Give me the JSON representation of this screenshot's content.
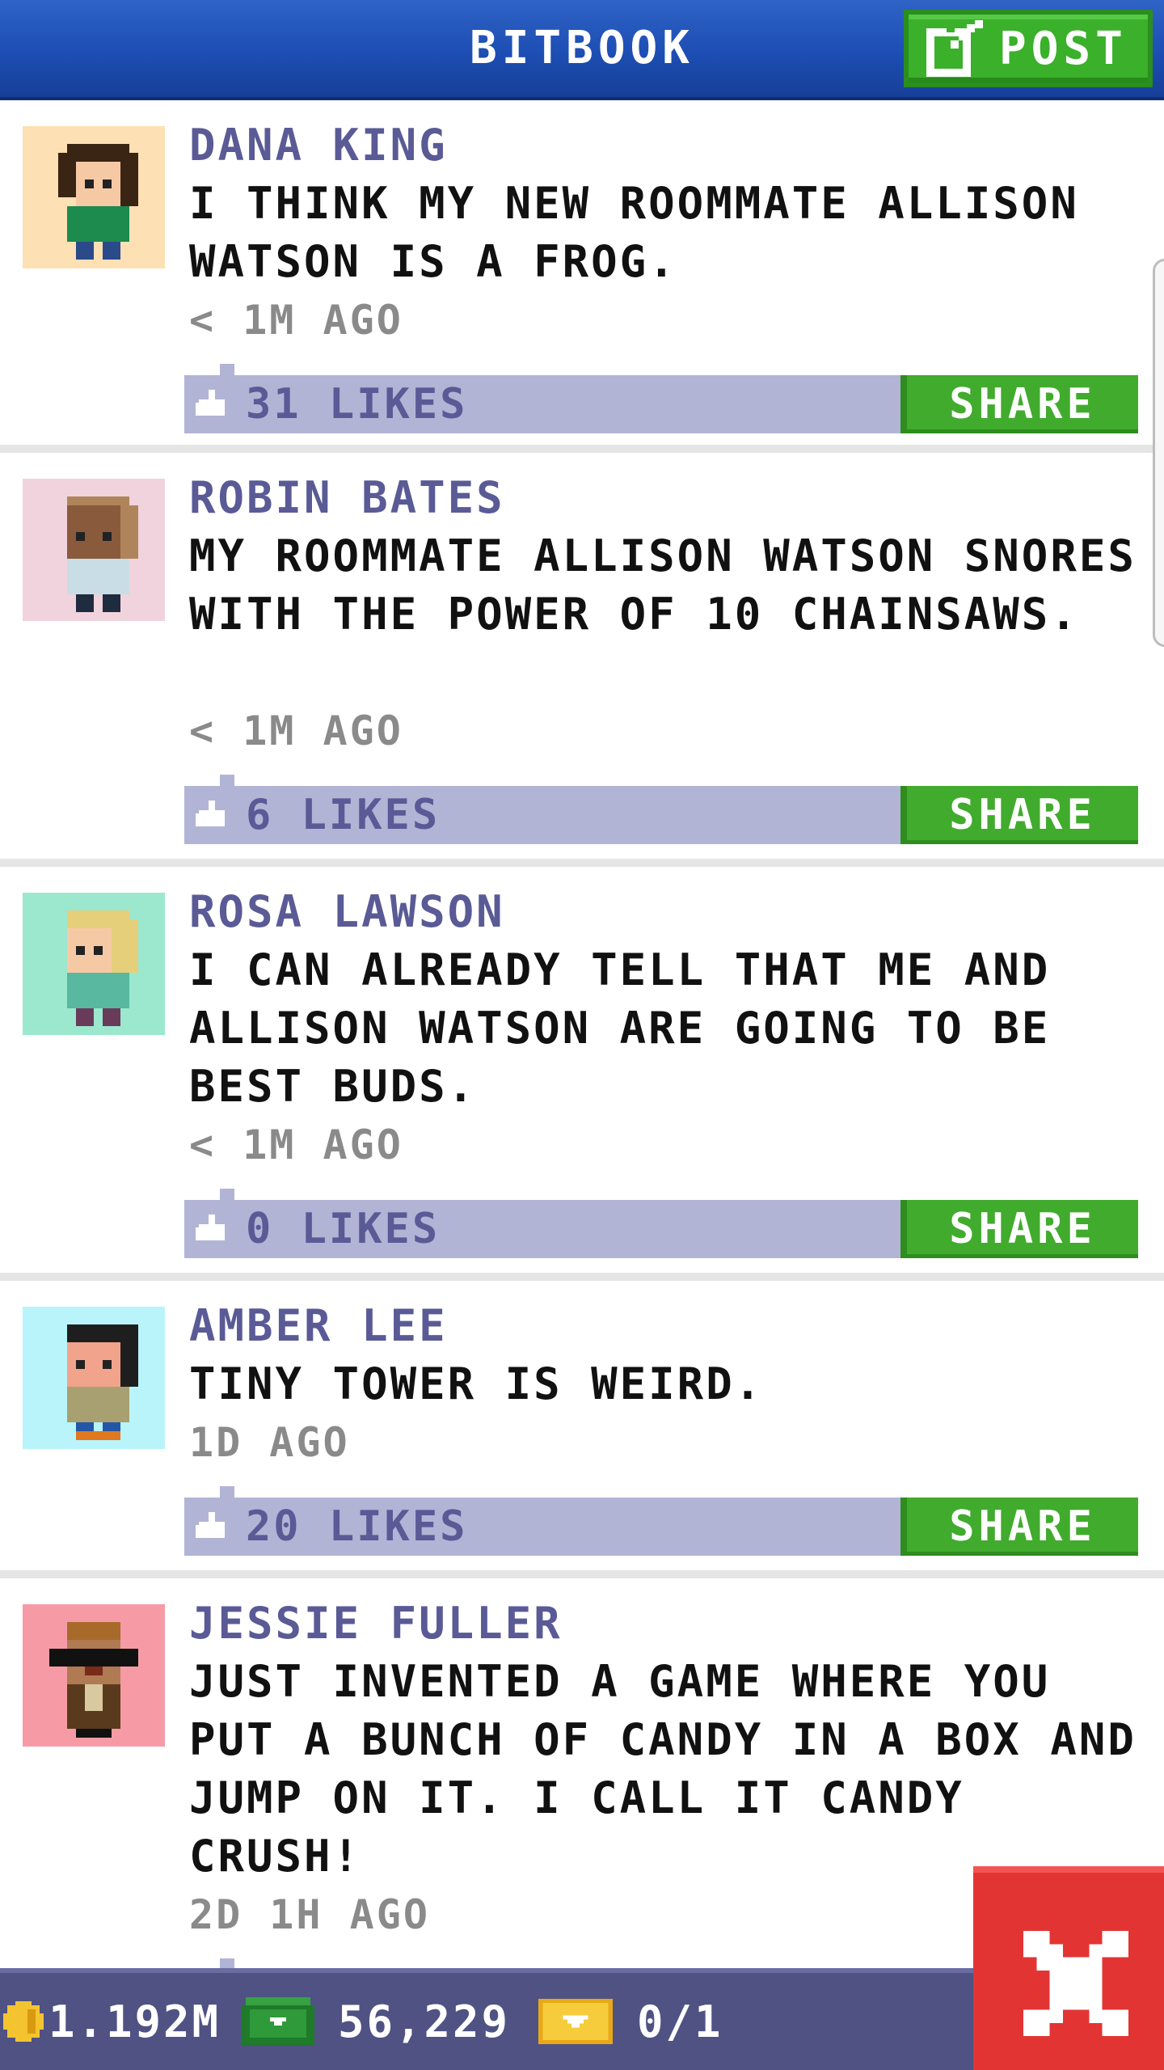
{
  "header": {
    "title": "BITBOOK",
    "post_label": "POST"
  },
  "posts": [
    {
      "author": "DANA KING",
      "text": "I THINK MY NEW ROOMMATE ALLISON WATSON IS A FROG.",
      "time": "< 1M AGO",
      "likes": "31 LIKES",
      "share_label": "SHARE",
      "avatar_bg": "#fde0b3"
    },
    {
      "author": "ROBIN BATES",
      "text": "MY ROOMMATE ALLISON WATSON SNORES WITH THE POWER OF 10 CHAINSAWS.",
      "time": "< 1M AGO",
      "likes": "6 LIKES",
      "share_label": "SHARE",
      "avatar_bg": "#f0d3dd"
    },
    {
      "author": "ROSA LAWSON",
      "text": "I CAN ALREADY TELL THAT ME AND ALLISON WATSON ARE GOING TO BE BEST BUDS.",
      "time": "< 1M AGO",
      "likes": "0 LIKES",
      "share_label": "SHARE",
      "avatar_bg": "#9be8cf"
    },
    {
      "author": "AMBER LEE",
      "text": "TINY TOWER IS WEIRD.",
      "time": "1D AGO",
      "likes": "20 LIKES",
      "share_label": "SHARE",
      "avatar_bg": "#b9f4fb"
    },
    {
      "author": "JESSIE FULLER",
      "text": "JUST INVENTED A GAME WHERE YOU PUT A BUNCH OF CANDY IN A BOX AND JUMP ON IT. I CALL IT CANDY CRUSH!",
      "time": "2D 1H AGO",
      "avatar_bg": "#f69ba6"
    }
  ],
  "footer": {
    "coins": "1.192M",
    "bux": "56,229",
    "tickets": "0/1"
  },
  "colors": {
    "header_blue": "#1d4eb3",
    "post_green": "#3bb02b",
    "likes_bar": "#b2b4d6",
    "author_purple": "#5a5a96",
    "bottom_bar": "#4f5283",
    "close_red": "#e33434"
  },
  "icons": [
    "compose-icon",
    "like-icon",
    "coin-icon",
    "bux-icon",
    "ticket-icon",
    "close-icon"
  ]
}
